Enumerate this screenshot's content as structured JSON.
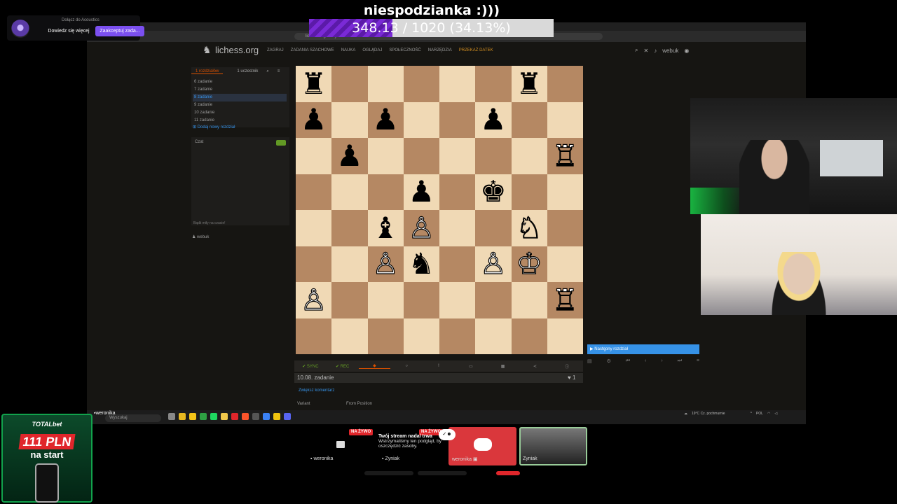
{
  "overlay": {
    "title": "niespodzianka :)))",
    "goal": {
      "text": "348.13 / 1020 (34.13%)",
      "progress_fraction": 0.3413
    }
  },
  "notification": {
    "tiny_text": "Dołącz do Acoustics",
    "learn_more": "Dowiedz się więcej",
    "accept": "Zaakceptuj zada..."
  },
  "browser": {
    "url": "lichess.org/study"
  },
  "lichess": {
    "logo": "lichess.org",
    "nav": [
      "ZAGRAJ",
      "ZADANIA SZACHOWE",
      "NAUKA",
      "OGLĄDAJ",
      "SPOŁECZNOŚĆ",
      "NARZĘDZIA",
      "PRZEKAŻ DATEK"
    ],
    "username": "webuk"
  },
  "study": {
    "tabs": [
      "1 rozdziałów",
      "1 uczestnik"
    ],
    "chapters": [
      "zadanie",
      "zadanie",
      "zadanie",
      "zadanie",
      "zadanie",
      "zadanie",
      "Rozdział 12"
    ],
    "chapter_numbers": [
      "6",
      "7",
      "8",
      "9",
      "10",
      "11"
    ],
    "add_chapter": "Dodaj nowy rozdział",
    "chat_label": "Czat",
    "chat_placeholder": "Bądź miły na czacie!",
    "member": "webuk",
    "toolbar": [
      "SYNC",
      "REC"
    ],
    "current": "10.08. zadanie",
    "likes": "1",
    "comment_link": "Zwiększ komentarz",
    "variant_label": "Variant",
    "variant_value": "From Position",
    "next_chapter": "Następny rozdział"
  },
  "board": {
    "ranks": [
      [
        "bR",
        "",
        "",
        "",
        "",
        "",
        "bR",
        ""
      ],
      [
        "bP",
        "",
        "bP",
        "",
        "",
        "bP",
        "",
        ""
      ],
      [
        "",
        "bP",
        "",
        "",
        "",
        "",
        "",
        "wR"
      ],
      [
        "",
        "",
        "",
        "bP",
        "",
        "bK",
        "",
        ""
      ],
      [
        "",
        "",
        "bB",
        "wP",
        "",
        "",
        "wN",
        ""
      ],
      [
        "",
        "",
        "wP",
        "bN",
        "",
        "wP",
        "wK",
        ""
      ],
      [
        "wP",
        "",
        "",
        "",
        "",
        "",
        "",
        "wR"
      ],
      [
        "",
        "",
        "",
        "",
        "",
        "",
        "",
        ""
      ]
    ],
    "glyphs": {
      "bR": "♜",
      "bP": "♟",
      "bK": "♚",
      "bB": "♝",
      "bN": "♞",
      "wR": "♖",
      "wP": "♙",
      "wK": "♔",
      "wN": "♘"
    },
    "light_color": "#f0d9b5",
    "dark_color": "#b58863"
  },
  "taskbar": {
    "user": "weronika",
    "search": "Wyszukaj",
    "weather": "19°C",
    "weather_sub": "Cz. pochmurnie",
    "lang": "POL"
  },
  "ad": {
    "brand": "TOTALbet",
    "amount": "111 PLN",
    "sub": "na start"
  },
  "participants": [
    {
      "name": "weronika",
      "live": "NA ŻYWO"
    },
    {
      "name": "Zyniak",
      "live": "NA ŻYWO",
      "popup_title": "Twój stream nadal trwa",
      "popup_text": "Wstrzymaliśmy ten podgląd, by oszczędzić zasoby."
    },
    {
      "name": "weronika"
    },
    {
      "name": "Zyniak"
    }
  ]
}
